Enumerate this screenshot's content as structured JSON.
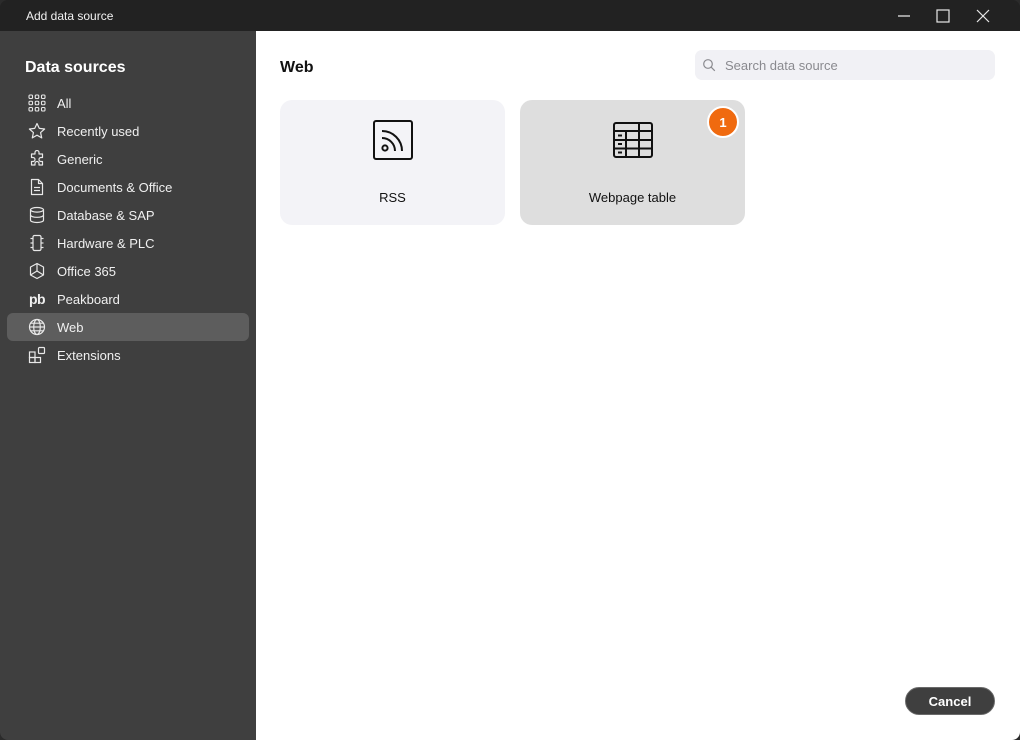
{
  "window": {
    "title": "Add data source"
  },
  "sidebar": {
    "heading": "Data sources",
    "items": [
      {
        "label": "All",
        "icon": "grid-dots-icon"
      },
      {
        "label": "Recently used",
        "icon": "star-icon"
      },
      {
        "label": "Generic",
        "icon": "puzzle-icon"
      },
      {
        "label": "Documents & Office",
        "icon": "document-icon"
      },
      {
        "label": "Database & SAP",
        "icon": "database-icon"
      },
      {
        "label": "Hardware & PLC",
        "icon": "chip-icon"
      },
      {
        "label": "Office 365",
        "icon": "office-icon"
      },
      {
        "label": "Peakboard",
        "icon": "peakboard-logo",
        "glyph": "pb"
      },
      {
        "label": "Web",
        "icon": "globe-icon",
        "active": true
      },
      {
        "label": "Extensions",
        "icon": "extensions-icon"
      }
    ]
  },
  "main": {
    "section_title": "Web",
    "search": {
      "placeholder": "Search data source",
      "value": ""
    },
    "cards": [
      {
        "label": "RSS",
        "icon": "rss-icon"
      },
      {
        "label": "Webpage table",
        "icon": "table-icon",
        "badge": "1"
      }
    ],
    "cancel_label": "Cancel"
  },
  "colors": {
    "sidebar_bg": "#3f3f3f",
    "active_item_bg": "#5d5d5d",
    "badge": "#f06a0f",
    "card_bg": "#f3f3f7",
    "card_selected_bg": "#dedede"
  }
}
